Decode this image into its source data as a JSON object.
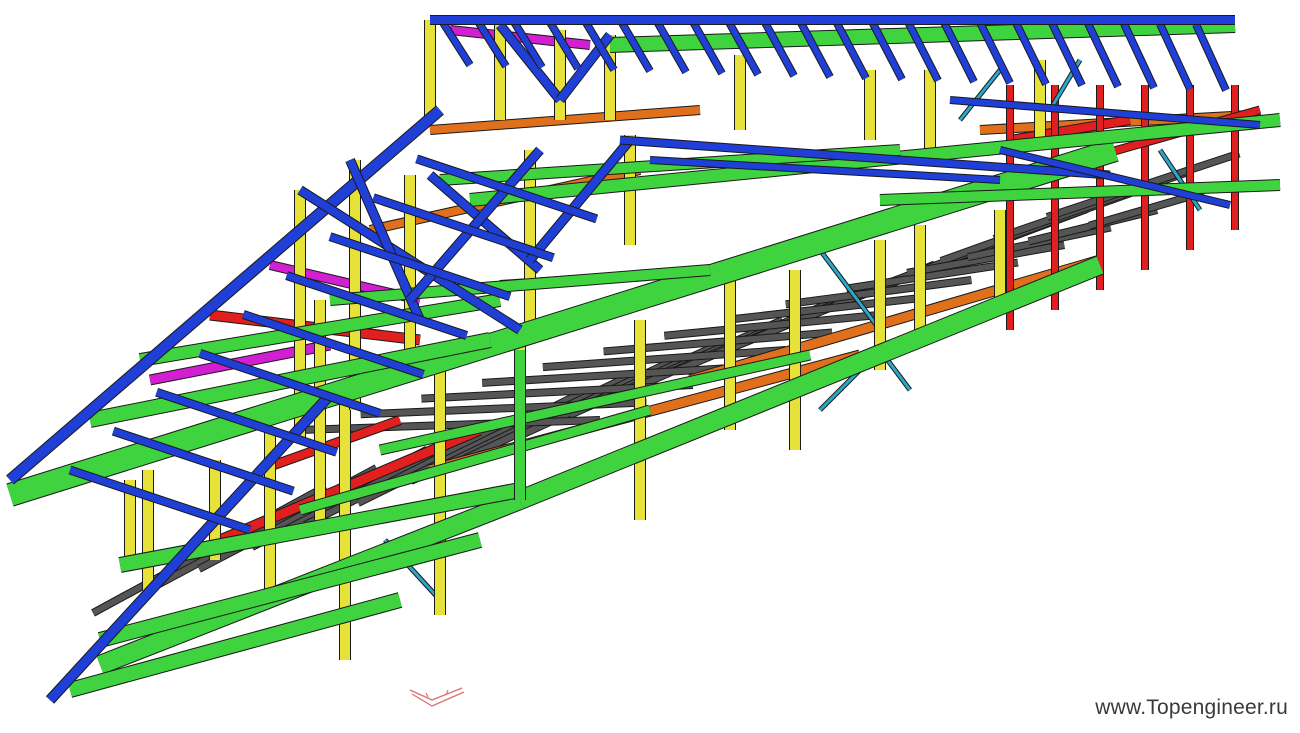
{
  "watermark": {
    "text": "www.Topengineer.ru"
  },
  "model": {
    "view": "3d-isometric-steel-frame"
  },
  "colors": {
    "background": "#ffffff",
    "main-beam": "#3fd43f",
    "column": "#e6e23a",
    "rafter": "#1f3fd6",
    "floor-joist": "#555555",
    "red-beam": "#e11f1f",
    "orange-beam": "#e0701c",
    "magenta-beam": "#d21fd2",
    "bracing": "#2aa7c9",
    "edge": "#1a1a1a"
  },
  "view_triad": {
    "icon": "coordinate-triad-icon"
  }
}
